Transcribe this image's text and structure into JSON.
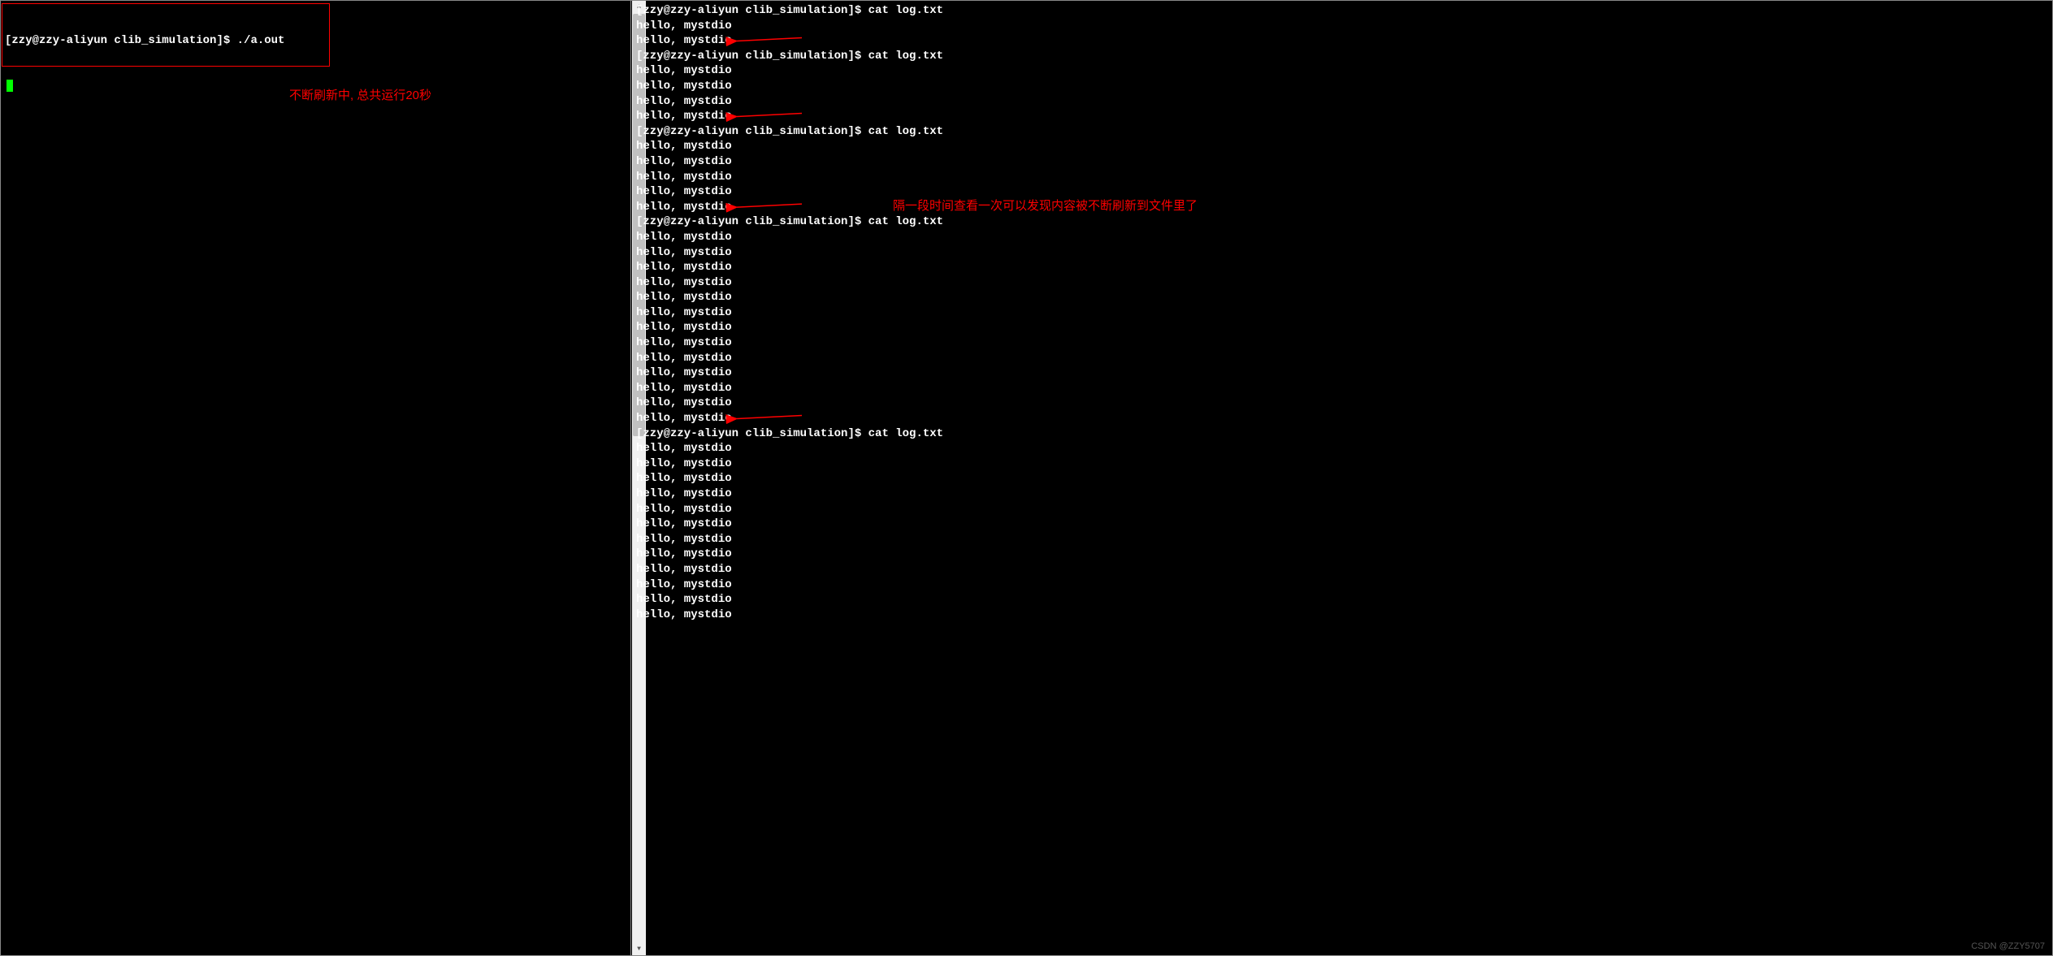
{
  "left": {
    "prompt": "[zzy@zzy-aliyun clib_simulation]$ ./a.out",
    "annotation": "不断刷新中, 总共运行20秒"
  },
  "right": {
    "annotation": "隔一段时间查看一次可以发现内容被不断刷新到文件里了",
    "prompt_base": "[zzy@zzy-aliyun clib_simulation]$ cat log.txt",
    "output_line": "hello, mystdio",
    "blocks": [
      {
        "prompt": true,
        "outputs": 2,
        "arrow": true
      },
      {
        "prompt": true,
        "outputs": 4,
        "arrow": true
      },
      {
        "prompt": true,
        "outputs": 5,
        "arrow": true
      },
      {
        "prompt": true,
        "outputs": 13,
        "arrow": true
      },
      {
        "prompt": true,
        "outputs": 12,
        "arrow": false
      }
    ]
  },
  "watermark": "CSDN @ZZY5707",
  "colors": {
    "bg": "#000000",
    "fg": "#ffffff",
    "annotation": "#ff0000",
    "cursor": "#00ff00",
    "scrollbar": "#f0f0f0"
  }
}
